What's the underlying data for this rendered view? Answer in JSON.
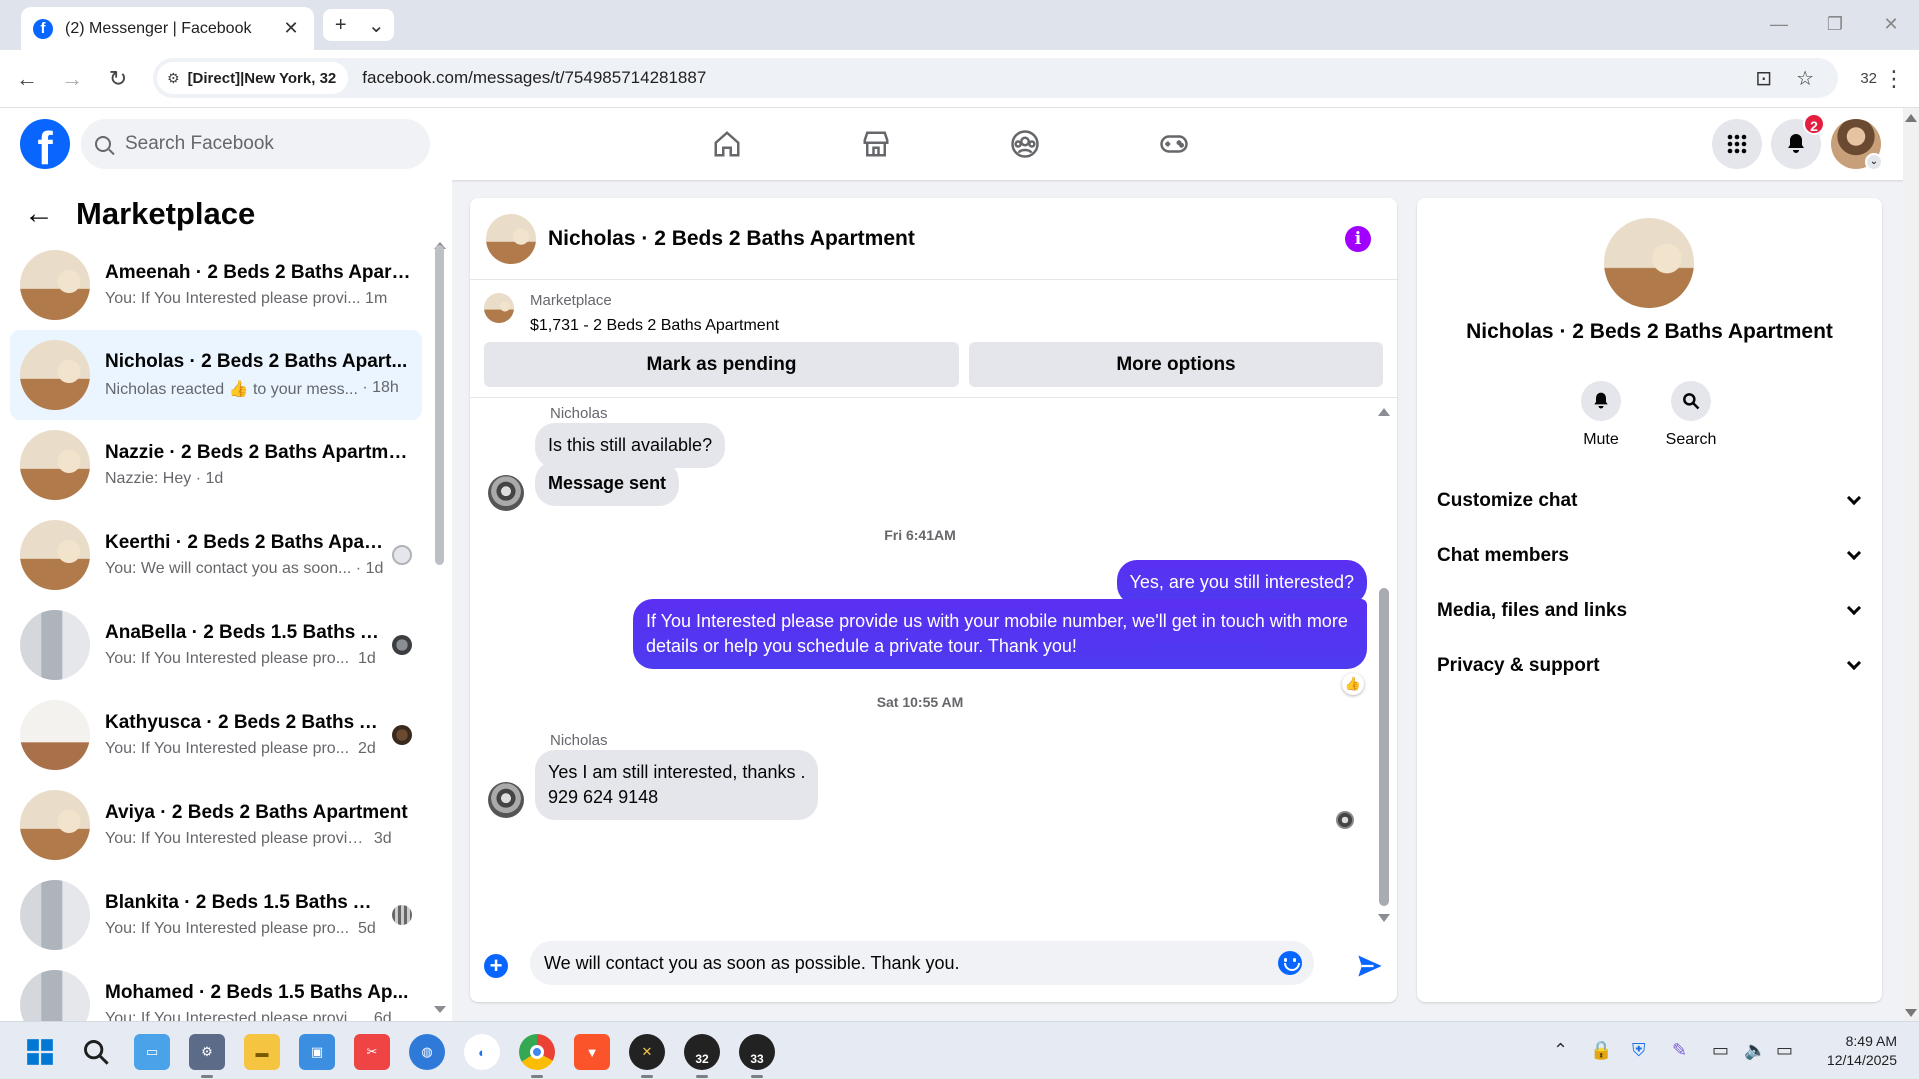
{
  "browser": {
    "tab_title": "(2) Messenger | Facebook",
    "site_info": "[Direct]|New York, 32",
    "url": "facebook.com/messages/t/754985714281887",
    "extension_count": "32"
  },
  "fb_header": {
    "search_placeholder": "Search Facebook",
    "notification_count": "2",
    "nav_icons": [
      "home-icon",
      "marketplace-icon",
      "groups-icon",
      "gaming-icon"
    ]
  },
  "sidebar": {
    "title": "Marketplace",
    "conversations": [
      {
        "name": "Ameenah · 2 Beds 2 Baths Apart...",
        "preview": "You: If You Interested please provi...",
        "time": "1m"
      },
      {
        "name": "Nicholas · 2 Beds 2 Baths Apart...",
        "preview": "Nicholas reacted 👍 to your mess...",
        "time": "18h"
      },
      {
        "name": "Nazzie · 2 Beds 2 Baths Apartme...",
        "preview": "Nazzie: Hey",
        "time": "1d"
      },
      {
        "name": "Keerthi · 2 Beds 2 Baths Apart...",
        "preview": "You: We will contact you as soon...",
        "time": "1d"
      },
      {
        "name": "AnaBella · 2 Beds 1.5 Baths Ap...",
        "preview": "You: If You Interested please pro...",
        "time": "1d"
      },
      {
        "name": "Kathyusca · 2 Beds 2 Baths Ap...",
        "preview": "You: If You Interested please pro...",
        "time": "2d"
      },
      {
        "name": "Aviya · 2 Beds 2 Baths Apartment",
        "preview": "You: If You Interested please provid...",
        "time": "3d"
      },
      {
        "name": "Blankita · 2 Beds 1.5 Baths Ap...",
        "preview": "You: If You Interested please pro...",
        "time": "5d"
      },
      {
        "name": "Mohamed · 2 Beds 1.5 Baths Ap...",
        "preview": "You: If You Interested please provid...",
        "time": "6d"
      }
    ]
  },
  "chat": {
    "title": "Nicholas · 2 Beds 2 Baths Apartment",
    "marketplace_label": "Marketplace",
    "listing": "$1,731 - 2 Beds 2 Baths Apartment",
    "mark_pending": "Mark as pending",
    "more_options": "More options",
    "messages": {
      "sender1": "Nicholas",
      "in1": "Is this still available?",
      "in2": "Message sent",
      "stamp1": "Fri 6:41AM",
      "out1": "Yes, are you still interested?",
      "out2": "If You Interested please provide us with your mobile number, we'll get in touch with more details or help you schedule a private tour. Thank you!",
      "stamp2": "Sat 10:55 AM",
      "sender2": "Nicholas",
      "in3_line1": "Yes I am still interested, thanks .",
      "in3_line2": "929 624 9148"
    },
    "composer_value": "We will contact you as soon as possible. Thank you."
  },
  "info_panel": {
    "name": "Nicholas · 2 Beds 2 Baths Apartment",
    "mute": "Mute",
    "search": "Search",
    "sections": [
      "Customize chat",
      "Chat members",
      "Media, files and links",
      "Privacy & support"
    ]
  },
  "taskbar": {
    "time": "8:49 AM",
    "date": "12/14/2025",
    "badge_a": "32",
    "badge_b": "33"
  }
}
